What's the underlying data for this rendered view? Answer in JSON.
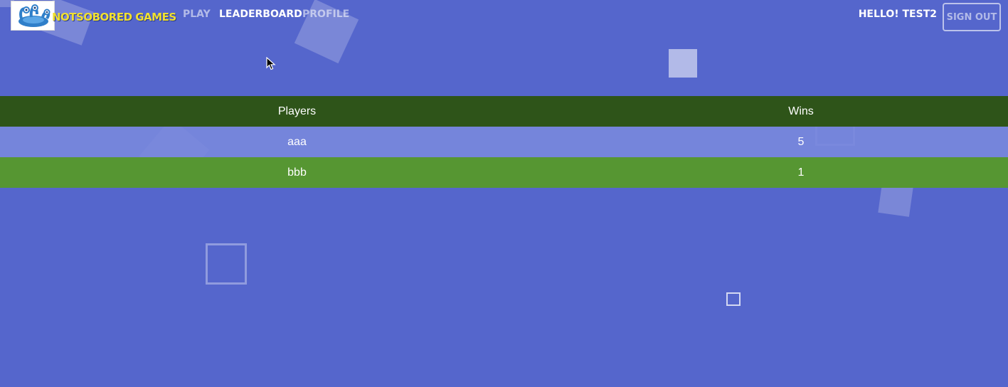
{
  "brand": {
    "name": "NOTSOBORED GAMES",
    "logo_icon": "blob-monster-logo-icon",
    "color": "#f0e030"
  },
  "nav": {
    "items": [
      {
        "label": "PLAY",
        "active": false
      },
      {
        "label": "LEADERBOARD",
        "active": true
      },
      {
        "label": "PROFILE",
        "active": false
      }
    ]
  },
  "user": {
    "greeting": "HELLO! TEST2",
    "signout_label": "SIGN OUT"
  },
  "leaderboard": {
    "columns": [
      "Players",
      "Wins"
    ],
    "rows": [
      {
        "player": "aaa",
        "wins": "5"
      },
      {
        "player": "bbb",
        "wins": "1"
      }
    ]
  },
  "colors": {
    "background": "#5566cc",
    "header_row": "#2e5419",
    "row_highlight": "#7080d8",
    "row_green": "#569632"
  }
}
